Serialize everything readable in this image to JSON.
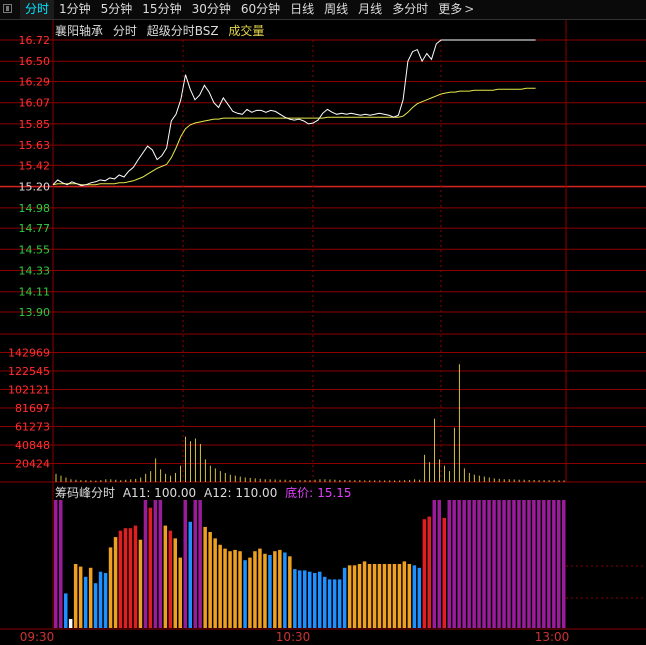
{
  "tabs": [
    {
      "label": "分时",
      "active": true
    },
    {
      "label": "1分钟"
    },
    {
      "label": "5分钟"
    },
    {
      "label": "15分钟"
    },
    {
      "label": "30分钟"
    },
    {
      "label": "60分钟"
    },
    {
      "label": "日线"
    },
    {
      "label": "周线"
    },
    {
      "label": "月线"
    },
    {
      "label": "多分时"
    },
    {
      "label": "更多"
    }
  ],
  "more_arrow": ">",
  "header": {
    "stock_name": "襄阳轴承",
    "period": "分时",
    "indicator": "超级分时BSZ",
    "volume_label": "成交量"
  },
  "sub_header": {
    "name": "筹码峰分时",
    "a11": "A11: 100.00",
    "a12": "A12: 110.00",
    "base_price_label": "底价:",
    "base_price_value": "15.15"
  },
  "colors": {
    "price_line": "#ffffff",
    "avg_line": "#e8e84a",
    "up": "#ff3030",
    "down": "#2ecc40",
    "grid": "#8b0000",
    "volume": "#d4c040",
    "chip_purple": "#9b1c9b",
    "chip_red": "#e02020",
    "chip_orange": "#f0a020",
    "chip_blue": "#1e90ff",
    "chip_white": "#ffffff"
  },
  "chart_data": [
    {
      "type": "line",
      "name": "price",
      "y_ticks": [
        "16.72",
        "16.50",
        "16.29",
        "16.07",
        "15.85",
        "15.63",
        "15.42",
        "15.20",
        "14.98",
        "14.77",
        "14.55",
        "14.33",
        "14.11",
        "13.90"
      ],
      "ylim": [
        13.9,
        16.72
      ],
      "prev_close": 15.2,
      "x_ticks": [
        "09:30",
        "10:30",
        "13:00"
      ],
      "series": [
        {
          "values": [
            15.22,
            15.27,
            15.24,
            15.22,
            15.25,
            15.23,
            15.21,
            15.22,
            15.24,
            15.25,
            15.27,
            15.26,
            15.29,
            15.28,
            15.32,
            15.3,
            15.36,
            15.4,
            15.48,
            15.55,
            15.62,
            15.58,
            15.48,
            15.52,
            15.6,
            15.88,
            15.95,
            16.1,
            16.36,
            16.21,
            16.1,
            16.15,
            16.25,
            16.18,
            16.07,
            16.02,
            16.12,
            16.05,
            15.98,
            15.96,
            15.95,
            16.0,
            15.97,
            15.99,
            15.99,
            15.97,
            15.99,
            15.98,
            15.95,
            15.92,
            15.9,
            15.89,
            15.9,
            15.88,
            15.85,
            15.86,
            15.89,
            15.96,
            16.0,
            15.97,
            15.95,
            15.96,
            15.95,
            15.96,
            15.95,
            15.94,
            15.95,
            15.94,
            15.95,
            15.96,
            15.95,
            15.94,
            15.92,
            15.94,
            16.1,
            16.5,
            16.6,
            16.62,
            16.5,
            16.58,
            16.52,
            16.68,
            16.72,
            16.72,
            16.72,
            16.72,
            16.72,
            16.72,
            16.72,
            16.72,
            16.72,
            16.72,
            16.72,
            16.72,
            16.72,
            16.72,
            16.72,
            16.72,
            16.72,
            16.72,
            16.72,
            16.72,
            16.72
          ]
        },
        {
          "values": [
            15.22,
            15.23,
            15.23,
            15.23,
            15.23,
            15.23,
            15.22,
            15.22,
            15.22,
            15.22,
            15.23,
            15.23,
            15.23,
            15.23,
            15.24,
            15.24,
            15.25,
            15.26,
            15.28,
            15.3,
            15.33,
            15.36,
            15.39,
            15.41,
            15.43,
            15.5,
            15.6,
            15.72,
            15.8,
            15.84,
            15.86,
            15.87,
            15.88,
            15.89,
            15.9,
            15.9,
            15.91,
            15.91,
            15.91,
            15.91,
            15.91,
            15.91,
            15.91,
            15.91,
            15.91,
            15.91,
            15.91,
            15.91,
            15.91,
            15.91,
            15.91,
            15.91,
            15.91,
            15.91,
            15.91,
            15.91,
            15.91,
            15.91,
            15.92,
            15.92,
            15.92,
            15.92,
            15.92,
            15.92,
            15.92,
            15.92,
            15.92,
            15.92,
            15.92,
            15.92,
            15.92,
            15.92,
            15.92,
            15.92,
            15.93,
            15.97,
            16.02,
            16.06,
            16.08,
            16.1,
            16.12,
            16.14,
            16.16,
            16.17,
            16.18,
            16.18,
            16.19,
            16.19,
            16.19,
            16.2,
            16.2,
            16.2,
            16.2,
            16.2,
            16.21,
            16.21,
            16.21,
            16.21,
            16.21,
            16.21,
            16.22,
            16.22,
            16.22
          ]
        }
      ]
    },
    {
      "type": "bar",
      "name": "volume",
      "y_ticks": [
        "142969",
        "122545",
        "102121",
        "81697",
        "61273",
        "40848",
        "20424"
      ],
      "ylim": [
        0,
        163393
      ],
      "values": [
        9000,
        7000,
        5000,
        3000,
        2500,
        2000,
        2000,
        1800,
        1500,
        2000,
        3000,
        3000,
        2500,
        2000,
        2500,
        3000,
        3500,
        5000,
        9000,
        12000,
        26000,
        14000,
        9000,
        7000,
        10000,
        18000,
        50000,
        45000,
        48000,
        42000,
        25000,
        18000,
        15000,
        12000,
        10000,
        8000,
        7000,
        6000,
        5000,
        4500,
        4000,
        3500,
        3000,
        3000,
        2800,
        2500,
        2500,
        2200,
        2000,
        2000,
        2200,
        2000,
        2500,
        3000,
        3000,
        2800,
        2500,
        2200,
        2200,
        2000,
        2000,
        2000,
        1800,
        1800,
        1800,
        1800,
        1800,
        1800,
        1800,
        1800,
        2000,
        2200,
        3000,
        2500,
        30000,
        22000,
        70000,
        25000,
        18000,
        12000,
        60000,
        130000,
        15000,
        10000,
        8000,
        7000,
        6000,
        5000,
        4000,
        3500,
        3000,
        3000,
        2800,
        2500,
        2500,
        2200,
        2200,
        2000,
        2000,
        2000,
        2000,
        1800,
        1800
      ]
    },
    {
      "type": "bar",
      "name": "chip_peak",
      "bars": [
        [
          "purple",
          100
        ],
        [
          "purple",
          100
        ],
        [
          "blue",
          27
        ],
        [
          "white",
          7
        ],
        [
          "orange",
          50
        ],
        [
          "orange",
          48
        ],
        [
          "blue",
          40
        ],
        [
          "orange",
          47
        ],
        [
          "blue",
          35
        ],
        [
          "blue",
          44
        ],
        [
          "blue",
          43
        ],
        [
          "orange",
          63
        ],
        [
          "orange",
          71
        ],
        [
          "red",
          76
        ],
        [
          "red",
          78
        ],
        [
          "red",
          78
        ],
        [
          "red",
          80
        ],
        [
          "orange",
          69
        ],
        [
          "purple",
          100
        ],
        [
          "red",
          94
        ],
        [
          "purple",
          100
        ],
        [
          "purple",
          100
        ],
        [
          "orange",
          80
        ],
        [
          "red",
          76
        ],
        [
          "orange",
          70
        ],
        [
          "orange",
          55
        ],
        [
          "purple",
          100
        ],
        [
          "blue",
          83
        ],
        [
          "purple",
          100
        ],
        [
          "purple",
          100
        ],
        [
          "orange",
          79
        ],
        [
          "orange",
          75
        ],
        [
          "orange",
          70
        ],
        [
          "orange",
          65
        ],
        [
          "orange",
          62
        ],
        [
          "orange",
          60
        ],
        [
          "orange",
          61
        ],
        [
          "orange",
          60
        ],
        [
          "blue",
          53
        ],
        [
          "orange",
          55
        ],
        [
          "orange",
          60
        ],
        [
          "orange",
          62
        ],
        [
          "orange",
          58
        ],
        [
          "blue",
          57
        ],
        [
          "orange",
          60
        ],
        [
          "orange",
          61
        ],
        [
          "blue",
          59
        ],
        [
          "orange",
          56
        ],
        [
          "blue",
          46
        ],
        [
          "blue",
          45
        ],
        [
          "blue",
          45
        ],
        [
          "blue",
          44
        ],
        [
          "blue",
          43
        ],
        [
          "blue",
          44
        ],
        [
          "blue",
          40
        ],
        [
          "blue",
          38
        ],
        [
          "blue",
          38
        ],
        [
          "blue",
          38
        ],
        [
          "blue",
          47
        ],
        [
          "orange",
          49
        ],
        [
          "orange",
          49
        ],
        [
          "orange",
          50
        ],
        [
          "orange",
          52
        ],
        [
          "orange",
          50
        ],
        [
          "orange",
          50
        ],
        [
          "orange",
          50
        ],
        [
          "orange",
          50
        ],
        [
          "orange",
          50
        ],
        [
          "orange",
          50
        ],
        [
          "orange",
          50
        ],
        [
          "orange",
          52
        ],
        [
          "orange",
          50
        ],
        [
          "blue",
          49
        ],
        [
          "blue",
          47
        ],
        [
          "red",
          85
        ],
        [
          "red",
          87
        ],
        [
          "purple",
          100
        ],
        [
          "purple",
          100
        ],
        [
          "red",
          86
        ],
        [
          "purple",
          100
        ],
        [
          "purple",
          100
        ],
        [
          "purple",
          100
        ],
        [
          "purple",
          100
        ],
        [
          "purple",
          100
        ],
        [
          "purple",
          100
        ],
        [
          "purple",
          100
        ],
        [
          "purple",
          100
        ],
        [
          "purple",
          100
        ],
        [
          "purple",
          100
        ],
        [
          "purple",
          100
        ],
        [
          "purple",
          100
        ],
        [
          "purple",
          100
        ],
        [
          "purple",
          100
        ],
        [
          "purple",
          100
        ],
        [
          "purple",
          100
        ],
        [
          "purple",
          100
        ],
        [
          "purple",
          100
        ],
        [
          "purple",
          100
        ],
        [
          "purple",
          100
        ],
        [
          "purple",
          100
        ],
        [
          "purple",
          100
        ],
        [
          "purple",
          100
        ],
        [
          "purple",
          100
        ]
      ]
    }
  ]
}
